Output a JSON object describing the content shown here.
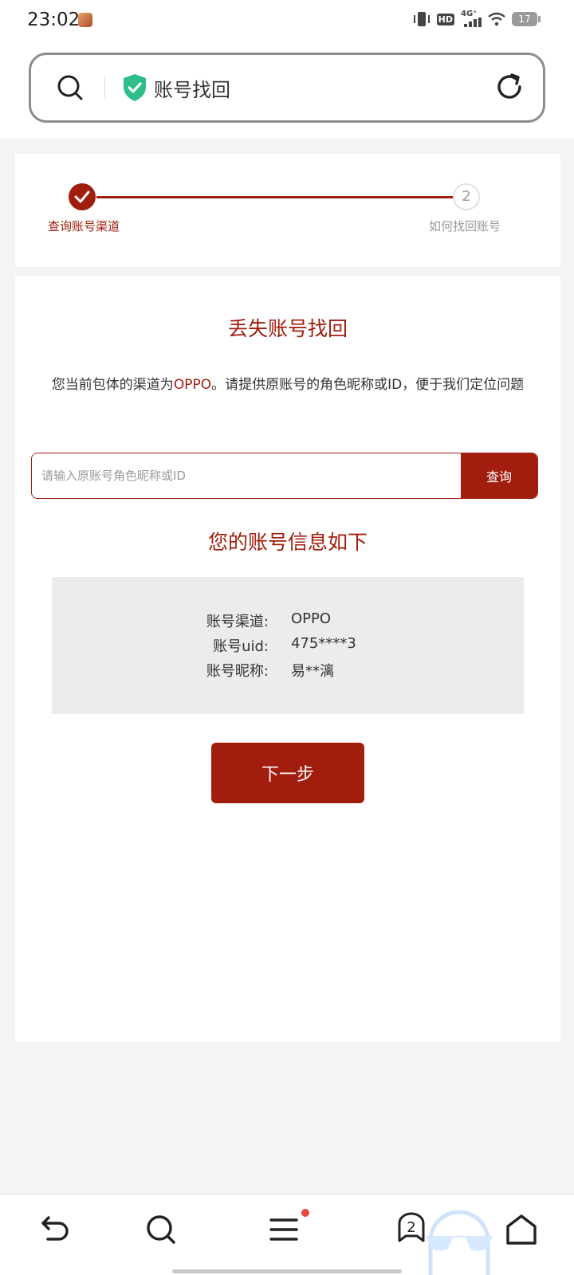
{
  "status_bar": {
    "time": "23:02",
    "network": "4G⁺",
    "hd": "HD",
    "battery": "17"
  },
  "address_bar": {
    "title": "账号找回",
    "icons": [
      "search-icon",
      "shield-check-icon",
      "refresh-icon"
    ]
  },
  "steps": [
    {
      "number": "1",
      "label": "查询账号渠道",
      "state": "done"
    },
    {
      "number": "2",
      "label": "如何找回账号",
      "state": "pending"
    }
  ],
  "main": {
    "title": "丢失账号找回",
    "desc_prefix": "您当前包体的渠道为",
    "desc_channel": "OPPO",
    "desc_suffix": "。请提供原账号的角色昵称或ID，便于我们定位问题",
    "input_placeholder": "请输入原账号角色昵称或ID",
    "input_value": "",
    "query_button": "查询",
    "result_title": "您的账号信息如下",
    "info": [
      {
        "label": "账号渠道:",
        "value": "OPPO"
      },
      {
        "label": "账号uid:",
        "value": "475****3"
      },
      {
        "label": "账号昵称:",
        "value": "易**漓"
      }
    ],
    "next_button": "下一步"
  },
  "bottom_nav": {
    "tabs_count": "2",
    "icons": [
      "back-icon",
      "search-icon",
      "menu-icon",
      "tabs-icon",
      "home-icon"
    ]
  },
  "colors": {
    "accent": "#a11d0d",
    "shield": "#2dbe8a",
    "notification_dot": "#e8453c"
  }
}
